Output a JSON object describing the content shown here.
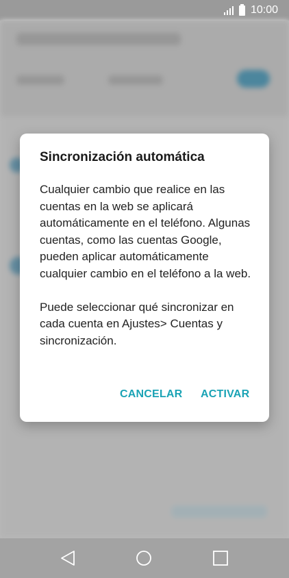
{
  "status_bar": {
    "time": "10:00",
    "signal_icon": "signal-icon",
    "battery_icon": "battery-icon"
  },
  "dialog": {
    "title": "Sincronización automática",
    "paragraph1": "Cualquier cambio que realice en las cuentas en la web se aplicará automáticamente en el teléfono. Algunas cuentas, como las cuentas Google, pueden aplicar automáticamente cualquier cambio en el teléfono a la web.",
    "paragraph2": "Puede seleccionar qué sincronizar en cada cuenta en Ajustes> Cuentas y sincronización.",
    "cancel_label": "CANCELAR",
    "activate_label": "ACTIVAR"
  },
  "colors": {
    "accent": "#1aa3b5",
    "status_bar": "#9a9a9a",
    "nav_bar": "#a3a3a3"
  },
  "nav_bar": {
    "back_icon": "back-triangle-icon",
    "home_icon": "home-circle-icon",
    "recent_icon": "recent-apps-square-icon"
  }
}
